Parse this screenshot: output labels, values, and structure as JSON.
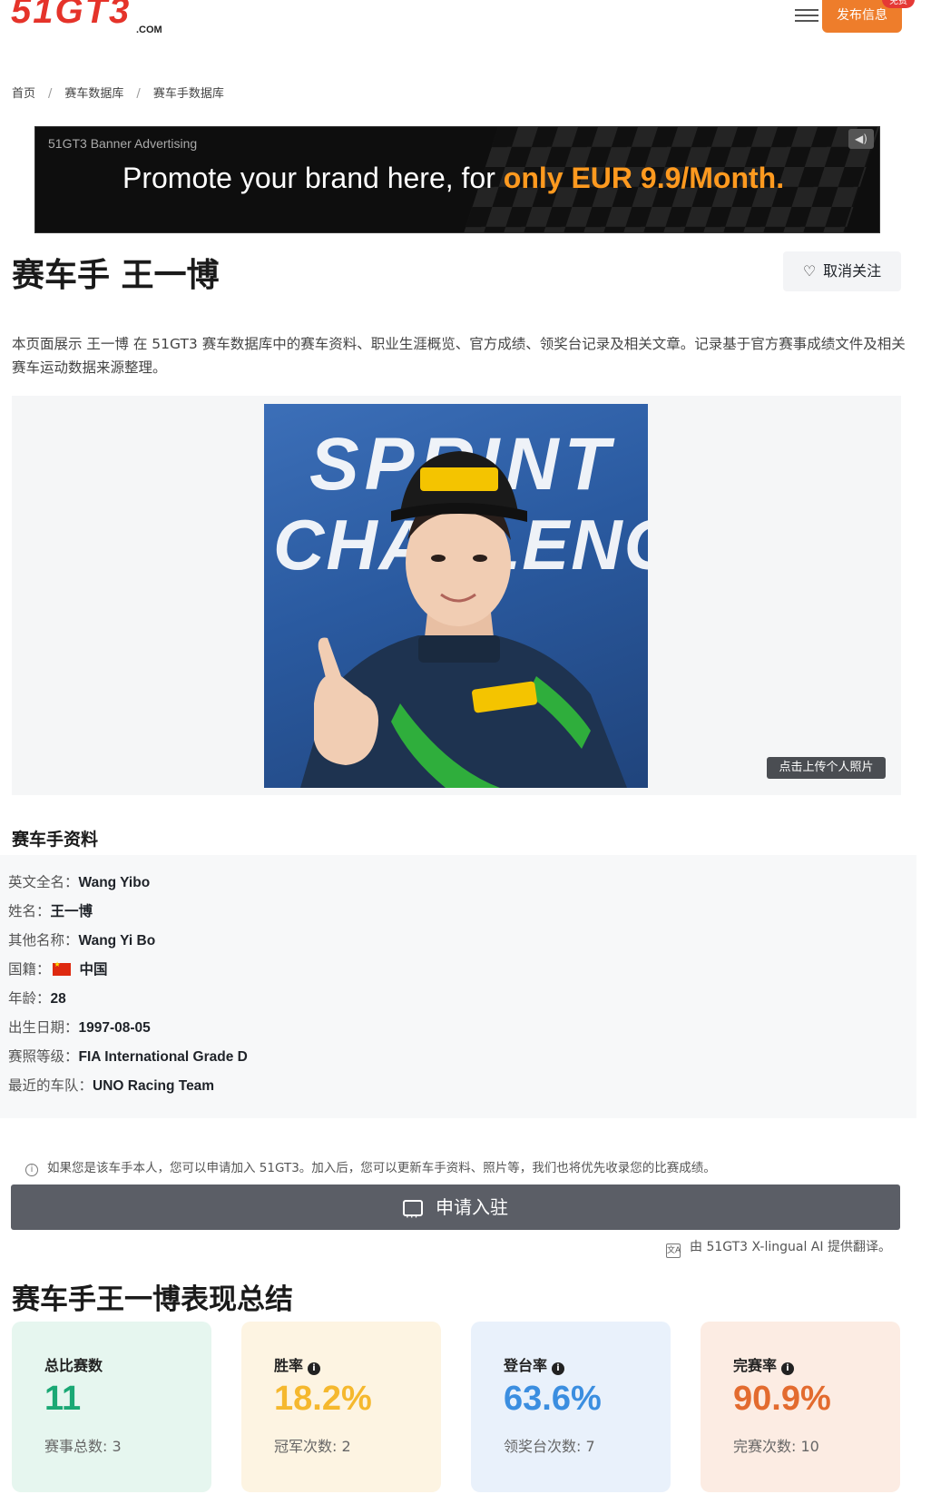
{
  "header": {
    "logo_text": "51GT3",
    "logo_domain": ".COM",
    "publish_label": "发布信息",
    "free_badge": "免费",
    "menu_icon": "hamburger-menu-icon"
  },
  "breadcrumb": [
    "首页",
    "赛车数据库",
    "赛车手数据库"
  ],
  "banner": {
    "small_text": "51GT3 Banner Advertising",
    "main_text": "Promote your brand here, for ",
    "highlight_text": "only EUR 9.9/Month.",
    "icon": "megaphone-icon"
  },
  "driver": {
    "title": "赛车手 王一博",
    "unfollow_label": "取消关注",
    "intro": "本页面展示 王一博 在 51GT3 赛车数据库中的赛车资料、职业生涯概览、官方成绩、领奖台记录及相关文章。记录基于官方赛事成绩文件及相关赛车运动数据来源整理。",
    "upload_photo_label": "点击上传个人照片",
    "photo_text_line1": "SPRINT",
    "photo_text_line2": "CHALLENGE"
  },
  "profile": {
    "section_title": "赛车手资料",
    "rows": [
      {
        "label": "英文全名：",
        "value": "Wang Yibo"
      },
      {
        "label": "姓名：",
        "value": "王一博"
      },
      {
        "label": "其他名称：",
        "value": "Wang Yi Bo"
      },
      {
        "label": "国籍：",
        "value": "中国"
      },
      {
        "label": "年龄：",
        "value": "28"
      },
      {
        "label": "出生日期：",
        "value": "1997-08-05"
      },
      {
        "label": "赛照等级：",
        "value": "FIA International Grade D"
      },
      {
        "label": "最近的车队：",
        "value": "UNO Racing Team"
      }
    ]
  },
  "join": {
    "note": "如果您是该车手本人，您可以申请加入 51GT3。加入后，您可以更新车手资料、照片等，我们也将优先收录您的比赛成绩。",
    "button_label": "申请入驻"
  },
  "translation_note": "由 51GT3 X-lingual AI 提供翻译。",
  "summary": {
    "title": "赛车手王一博表现总结",
    "cards": [
      {
        "label": "总比赛数",
        "value": "11",
        "sub": "赛事总数: 3",
        "color": "#1aa874",
        "bg": "#e6f6ef",
        "info": false
      },
      {
        "label": "胜率",
        "value": "18.2%",
        "sub": "冠军次数: 2",
        "color": "#f5b82e",
        "bg": "#fdf4e2",
        "info": true
      },
      {
        "label": "登台率",
        "value": "63.6%",
        "sub": "领奖台次数: 7",
        "color": "#3b8ee0",
        "bg": "#e9f1fb",
        "info": true
      },
      {
        "label": "完赛率",
        "value": "90.9%",
        "sub": "完赛次数: 10",
        "color": "#e36b2f",
        "bg": "#fcece3",
        "info": true
      }
    ]
  }
}
